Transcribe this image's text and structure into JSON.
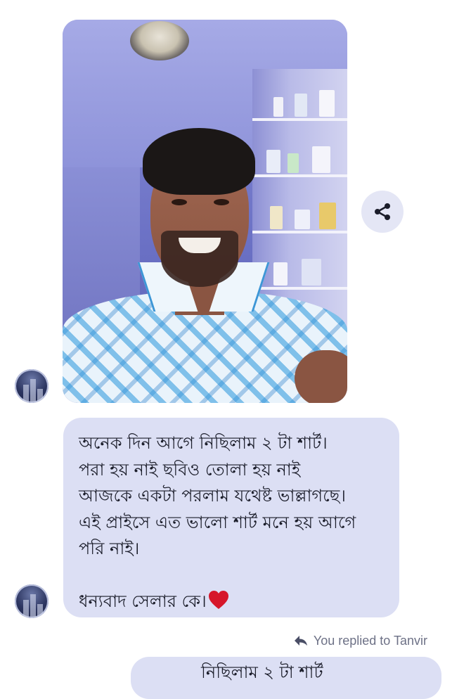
{
  "chat": {
    "share_icon": "share-icon",
    "message": {
      "lines": [
        "অনেক দিন আগে নিছিলাম ২ টা শার্ট।",
        "পরা হয় নাই ছবিও তোলা হয় নাই",
        "আজকে একটা পরলাম যথেষ্ট ভাল্লাগছে।",
        "এই প্রাইসে এত ভালো শার্ট মনে হয় আগে",
        "পরি নাই।"
      ],
      "thanks": "ধন্যবাদ সেলার কে।",
      "heart_emoji": "❤",
      "heart_color": "#d6162a"
    },
    "reply_indicator": "You replied to Tanvir",
    "reply_icon": "reply-arrow-icon",
    "next_message_partial": "নিছিলাম ২ টা শার্ট"
  },
  "colors": {
    "bubble": "#dcdff4",
    "text": "#1b1d2a",
    "muted": "#6d7186",
    "share_button": "#e4e6f5"
  }
}
